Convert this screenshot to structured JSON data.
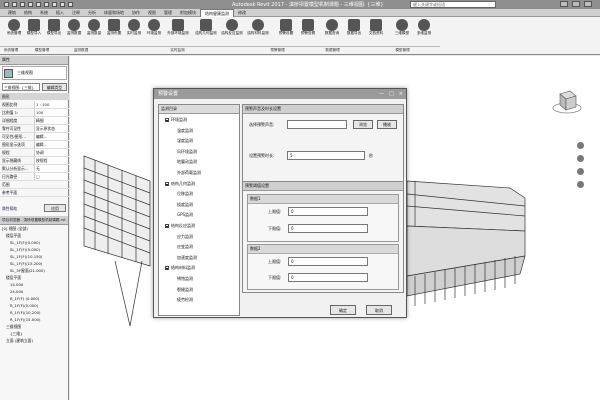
{
  "app": {
    "title": "Autodesk Revit 2017 -   滇桥坝置模型机制课题 - 三维视图: {三维}",
    "search_placeholder": "键入关键字或短语"
  },
  "ribbon": {
    "tabs": [
      "建筑",
      "结构",
      "系统",
      "插入",
      "注释",
      "分析",
      "体量和场地",
      "协作",
      "视图",
      "管理",
      "附加模块",
      "结构健康监测",
      "修改"
    ],
    "active_tab": "结构健康监测",
    "buttons": [
      {
        "label": "系统管理",
        "icon": "gear-icon"
      },
      {
        "label": "模型导入",
        "icon": "import-icon"
      },
      {
        "label": "模型导出",
        "icon": "export-icon"
      },
      {
        "label": "监测数据",
        "icon": "data-icon"
      },
      {
        "label": "监测数量",
        "icon": "count-icon"
      },
      {
        "label": "监测布置",
        "icon": "layout-icon"
      },
      {
        "label": "实时监测",
        "icon": "monitor-icon"
      },
      {
        "label": "环境监测",
        "icon": "env-icon"
      },
      {
        "label": "外部环境监测",
        "icon": "env-ext-icon"
      },
      {
        "label": "结构几何监测",
        "icon": "geometry-icon"
      },
      {
        "label": "结构反应监测",
        "icon": "response-icon"
      },
      {
        "label": "结构材料监测",
        "icon": "material-icon"
      },
      {
        "label": "预警设置",
        "icon": "alarm-icon"
      },
      {
        "label": "预警查看",
        "icon": "alarm-view-icon"
      },
      {
        "label": "数据查询",
        "icon": "query-icon"
      },
      {
        "label": "数据导出",
        "icon": "data-export-icon"
      },
      {
        "label": "文档资料",
        "icon": "doc-icon"
      },
      {
        "label": "三维模型",
        "icon": "model-icon"
      },
      {
        "label": "多维监测",
        "icon": "multi-icon"
      }
    ],
    "groups": [
      "系统管理",
      "模型管理",
      "监测数据",
      "实时监测",
      "预警管理",
      "数据管理",
      "模型管理"
    ]
  },
  "properties": {
    "header": "属性",
    "type_name": "三维视图",
    "selector": "三维视图: {三维}",
    "edit_type": "编辑类型",
    "section": "图形",
    "rows": [
      {
        "k": "视图比例",
        "v": "1 : 100"
      },
      {
        "k": "比例值 1:",
        "v": "100"
      },
      {
        "k": "详细程度",
        "v": "精细"
      },
      {
        "k": "零件可见性",
        "v": "显示原状态"
      },
      {
        "k": "可见性/图形...",
        "v": "编辑..."
      },
      {
        "k": "图形显示选项",
        "v": "编辑..."
      },
      {
        "k": "规程",
        "v": "协调"
      },
      {
        "k": "显示隐藏线",
        "v": "按规程"
      },
      {
        "k": "默认分析显示...",
        "v": "无"
      },
      {
        "k": "日光路径",
        "v": "□"
      },
      {
        "k": "范围",
        "v": ""
      },
      {
        "k": "参考平面",
        "v": ""
      }
    ],
    "apply": "应用",
    "help": "属性帮助"
  },
  "browser": {
    "header": "项目浏览器 - 滇桥坝置模型机制课题.rvt",
    "items": [
      "[0] 视图 (全部)",
      "楼层平面",
      "SL_1F(F)(0.000)",
      "SL_1F(F)(5.000)",
      "SL_1F(F)(10.150)",
      "SL_1F(F)(15.200)",
      "SL_5F屋面(21.000)",
      "楼层平面",
      "14.000",
      "24.000",
      "R_1F(F) (0.000)",
      "R_1F(F)(5.000)",
      "R_1F(F)(10.200)",
      "R_1F(F)(15.000)",
      "三维视图",
      "{三维}",
      "立面 (建筑立面)"
    ]
  },
  "dialog": {
    "title": "预警设置",
    "tree_header": "监测目录",
    "tree": [
      {
        "label": "环境监测",
        "level": 1
      },
      {
        "label": "温度监测",
        "level": 2
      },
      {
        "label": "湿度监测",
        "level": 2
      },
      {
        "label": "风环境监测",
        "level": 2
      },
      {
        "label": "地震动监测",
        "level": 2
      },
      {
        "label": "外部荷载监测",
        "level": 2
      },
      {
        "label": "结构几何监测",
        "level": 1
      },
      {
        "label": "位移监测",
        "level": 2
      },
      {
        "label": "挠度监测",
        "level": 2
      },
      {
        "label": "GPS监测",
        "level": 2
      },
      {
        "label": "结构反应监测",
        "level": 1
      },
      {
        "label": "应力监测",
        "level": 2
      },
      {
        "label": "应变监测",
        "level": 2
      },
      {
        "label": "加速度监测",
        "level": 2
      },
      {
        "label": "结构材料监测",
        "level": 1
      },
      {
        "label": "锈蚀监测",
        "level": 2
      },
      {
        "label": "裂缝监测",
        "level": 2
      },
      {
        "label": "疲劳检测",
        "level": 2
      }
    ],
    "sound_section": {
      "title": "预警声音及时长设置",
      "sound_label": "选择预警声音:",
      "sound_value": "",
      "browse_btn": "浏览",
      "play_btn": "播放",
      "duration_label": "设置预警时长:",
      "duration_value": "5",
      "unit": "秒"
    },
    "threshold_section": {
      "title": "预警阈值设置",
      "groups": [
        {
          "name": "数据1",
          "upper_label": "上限值:",
          "upper": "0",
          "lower_label": "下限值:",
          "lower": "0"
        },
        {
          "name": "数据2",
          "upper_label": "上限值:",
          "upper": "0",
          "lower_label": "下限值:",
          "lower": "0"
        }
      ]
    },
    "ok_btn": "确定",
    "cancel_btn": "取消"
  }
}
